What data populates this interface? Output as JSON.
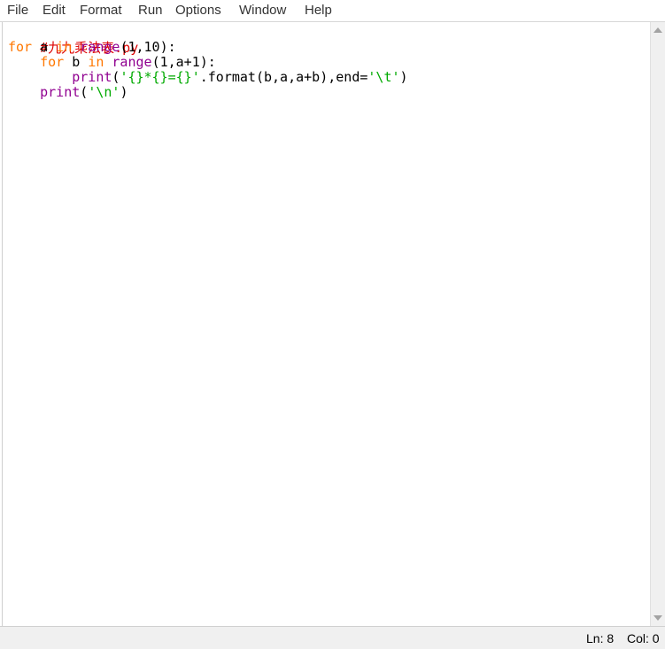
{
  "menu": {
    "file": "File",
    "edit": "Edit",
    "format": "Format",
    "run": "Run",
    "options": "Options",
    "window": "Window",
    "help": "Help"
  },
  "code": {
    "line1": {
      "comment": "#九九乘法表.py"
    },
    "line2": {
      "kw_for": "for",
      "var": " a ",
      "kw_in": "in",
      "sp": " ",
      "bi_range": "range",
      "rest": "(1,10):"
    },
    "line3": {
      "indent": "    ",
      "kw_for": "for",
      "var": " b ",
      "kw_in": "in",
      "sp": " ",
      "bi_range": "range",
      "rest": "(1,a+1):"
    },
    "line4": {
      "indent": "        ",
      "bi_print": "print",
      "p1": "(",
      "str1": "'{}*{}={}'",
      "p2": ".format(b,a,a+b),end=",
      "str2": "'\\t'",
      "p3": ")"
    },
    "line5": {
      "indent": "    ",
      "bi_print": "print",
      "p1": "(",
      "str1": "'\\n'",
      "p2": ")"
    }
  },
  "status": {
    "ln": "Ln: 8",
    "col": "Col: 0"
  },
  "colors": {
    "keyword": "#ff7700",
    "builtin": "#900090",
    "string": "#00aa00",
    "comment": "#dd0000"
  }
}
